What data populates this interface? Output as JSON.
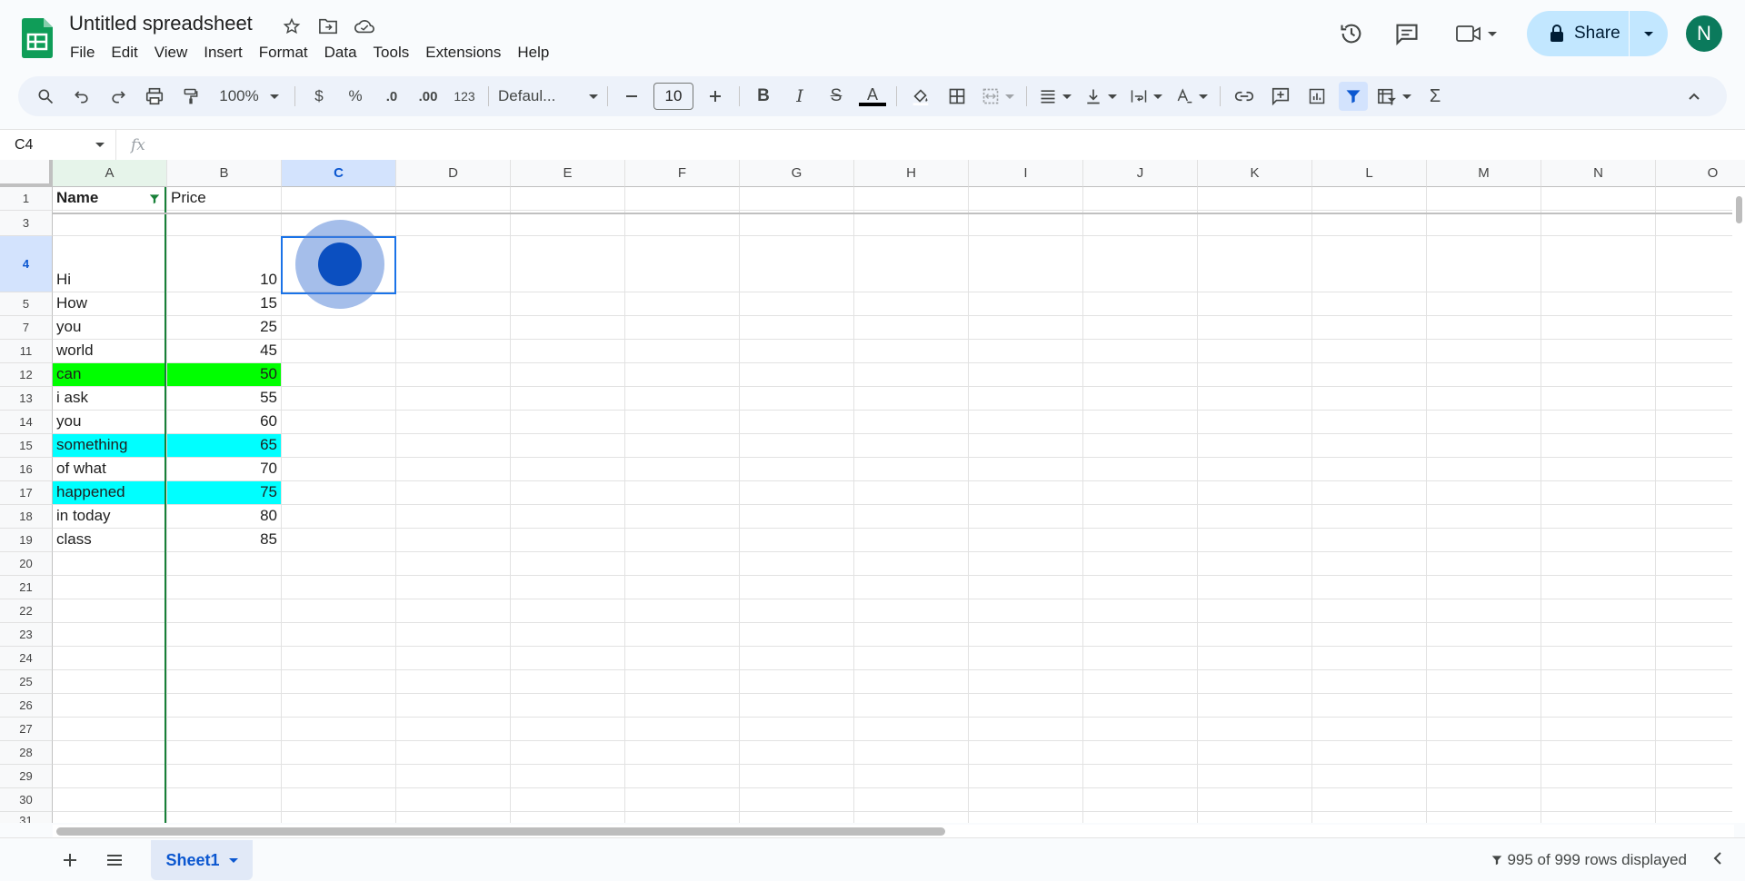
{
  "app": {
    "title": "Untitled spreadsheet",
    "menu": [
      "File",
      "Edit",
      "View",
      "Insert",
      "Format",
      "Data",
      "Tools",
      "Extensions",
      "Help"
    ],
    "share_label": "Share",
    "avatar_initial": "N",
    "accent": "#0b57d0",
    "logo_color": "#0f9d58"
  },
  "toolbar": {
    "zoom": "100%",
    "currency": "$",
    "percent": "%",
    "dec_decrease": ".0",
    "dec_increase": ".00",
    "format_123": "123",
    "font": "Defaul...",
    "font_size": "10",
    "bold": "B",
    "italic": "I",
    "strike": "S",
    "text_color": "A",
    "sum": "Σ"
  },
  "formula_bar": {
    "name_box": "C4",
    "fx": "fx",
    "value": ""
  },
  "columns": [
    "A",
    "B",
    "C",
    "D",
    "E",
    "F",
    "G",
    "H",
    "I",
    "J",
    "K",
    "L",
    "M",
    "N",
    "O"
  ],
  "selected_column": "C",
  "rows": [
    {
      "num": "1",
      "a": "Name",
      "b": "Price",
      "header": true
    },
    {
      "num": "3",
      "a": "",
      "b": ""
    },
    {
      "num": "4",
      "a": "Hi",
      "b": "10",
      "selected": true
    },
    {
      "num": "5",
      "a": "How",
      "b": "15"
    },
    {
      "num": "7",
      "a": "you",
      "b": "25"
    },
    {
      "num": "11",
      "a": "world",
      "b": "45"
    },
    {
      "num": "12",
      "a": "can",
      "b": "50",
      "fill": "#00ff00"
    },
    {
      "num": "13",
      "a": "i ask",
      "b": "55"
    },
    {
      "num": "14",
      "a": "you",
      "b": "60"
    },
    {
      "num": "15",
      "a": "something",
      "b": "65",
      "fill": "#00ffff"
    },
    {
      "num": "16",
      "a": "of what",
      "b": "70"
    },
    {
      "num": "17",
      "a": "happened",
      "b": "75",
      "fill": "#00ffff"
    },
    {
      "num": "18",
      "a": "in today",
      "b": "80"
    },
    {
      "num": "19",
      "a": "class",
      "b": "85"
    },
    {
      "num": "20",
      "a": "",
      "b": ""
    },
    {
      "num": "21",
      "a": "",
      "b": ""
    },
    {
      "num": "22",
      "a": "",
      "b": ""
    },
    {
      "num": "23",
      "a": "",
      "b": ""
    },
    {
      "num": "24",
      "a": "",
      "b": ""
    },
    {
      "num": "25",
      "a": "",
      "b": ""
    },
    {
      "num": "26",
      "a": "",
      "b": ""
    },
    {
      "num": "27",
      "a": "",
      "b": ""
    },
    {
      "num": "28",
      "a": "",
      "b": ""
    },
    {
      "num": "29",
      "a": "",
      "b": ""
    },
    {
      "num": "30",
      "a": "",
      "b": ""
    },
    {
      "num": "31",
      "a": "",
      "b": ""
    }
  ],
  "sheets": [
    {
      "name": "Sheet1",
      "active": true
    }
  ],
  "status": {
    "rows_displayed": "995 of 999 rows displayed"
  }
}
